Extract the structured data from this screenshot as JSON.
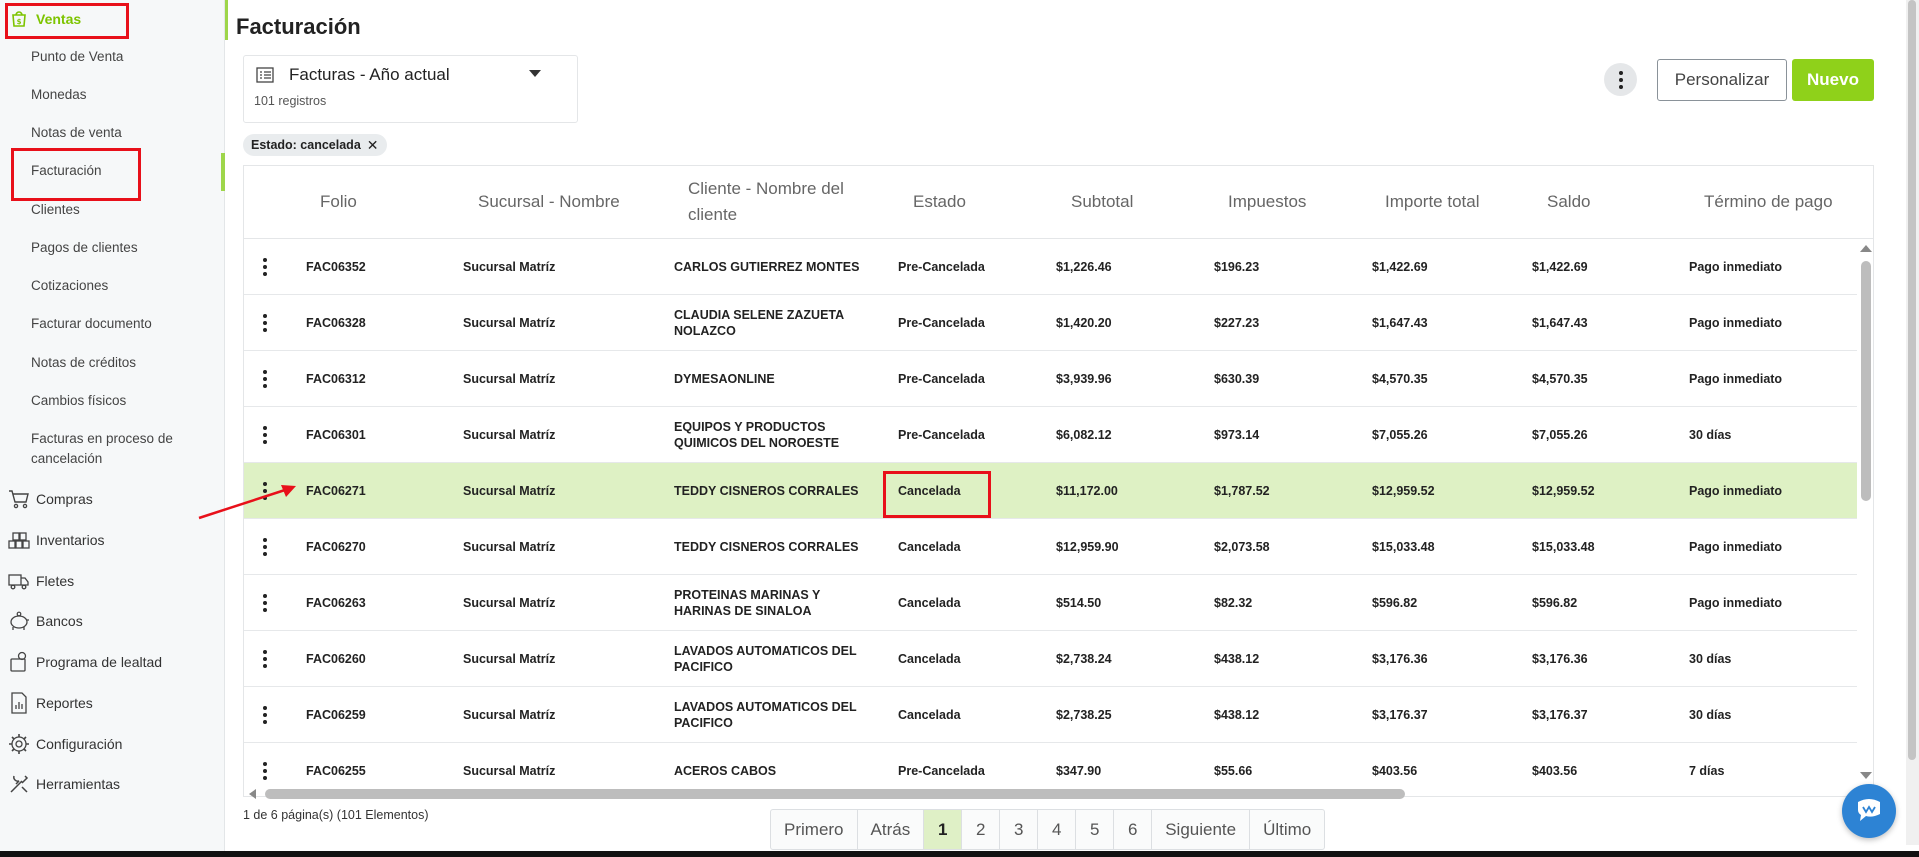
{
  "sidebar": {
    "ventas": "Ventas",
    "subitems": [
      "Punto de Venta",
      "Monedas",
      "Notas de venta",
      "Facturación",
      "Clientes",
      "Pagos de clientes",
      "Cotizaciones",
      "Facturar documento",
      "Notas de créditos",
      "Cambios físicos",
      "Facturas en proceso de",
      "cancelación"
    ],
    "parents": [
      "Compras",
      "Inventarios",
      "Fletes",
      "Bancos",
      "Programa de lealtad",
      "Reportes",
      "Configuración",
      "Herramientas"
    ]
  },
  "page": {
    "title": "Facturación",
    "view_name": "Facturas - Año actual",
    "record_count": "101 registros",
    "filter_chip": "Estado: cancelada",
    "personalizar": "Personalizar",
    "nuevo": "Nuevo"
  },
  "table": {
    "headers": [
      "Folio",
      "Sucursal - Nombre",
      "Cliente - Nombre del",
      "cliente",
      "Estado",
      "Subtotal",
      "Impuestos",
      "Importe total",
      "Saldo",
      "Término de pago"
    ],
    "rows": [
      {
        "folio": "FAC06352",
        "sucursal": "Sucursal Matríz",
        "cliente1": "CARLOS GUTIERREZ MONTES",
        "cliente2": "",
        "estado": "Pre-Cancelada",
        "subtotal": "$1,226.46",
        "impuestos": "$196.23",
        "total": "$1,422.69",
        "saldo": "$1,422.69",
        "termino": "Pago inmediato"
      },
      {
        "folio": "FAC06328",
        "sucursal": "Sucursal Matríz",
        "cliente1": "CLAUDIA SELENE ZAZUETA",
        "cliente2": "NOLAZCO",
        "estado": "Pre-Cancelada",
        "subtotal": "$1,420.20",
        "impuestos": "$227.23",
        "total": "$1,647.43",
        "saldo": "$1,647.43",
        "termino": "Pago inmediato"
      },
      {
        "folio": "FAC06312",
        "sucursal": "Sucursal Matríz",
        "cliente1": "DYMESAONLINE",
        "cliente2": "",
        "estado": "Pre-Cancelada",
        "subtotal": "$3,939.96",
        "impuestos": "$630.39",
        "total": "$4,570.35",
        "saldo": "$4,570.35",
        "termino": "Pago inmediato"
      },
      {
        "folio": "FAC06301",
        "sucursal": "Sucursal Matríz",
        "cliente1": "EQUIPOS Y PRODUCTOS",
        "cliente2": "QUIMICOS DEL NOROESTE",
        "estado": "Pre-Cancelada",
        "subtotal": "$6,082.12",
        "impuestos": "$973.14",
        "total": "$7,055.26",
        "saldo": "$7,055.26",
        "termino": "30 días"
      },
      {
        "folio": "FAC06271",
        "sucursal": "Sucursal Matríz",
        "cliente1": "TEDDY CISNEROS CORRALES",
        "cliente2": "",
        "estado": "Cancelada",
        "subtotal": "$11,172.00",
        "impuestos": "$1,787.52",
        "total": "$12,959.52",
        "saldo": "$12,959.52",
        "termino": "Pago inmediato"
      },
      {
        "folio": "FAC06270",
        "sucursal": "Sucursal Matríz",
        "cliente1": "TEDDY CISNEROS CORRALES",
        "cliente2": "",
        "estado": "Cancelada",
        "subtotal": "$12,959.90",
        "impuestos": "$2,073.58",
        "total": "$15,033.48",
        "saldo": "$15,033.48",
        "termino": "Pago inmediato"
      },
      {
        "folio": "FAC06263",
        "sucursal": "Sucursal Matríz",
        "cliente1": "PROTEINAS MARINAS Y",
        "cliente2": "HARINAS DE SINALOA",
        "estado": "Cancelada",
        "subtotal": "$514.50",
        "impuestos": "$82.32",
        "total": "$596.82",
        "saldo": "$596.82",
        "termino": "Pago inmediato"
      },
      {
        "folio": "FAC06260",
        "sucursal": "Sucursal Matríz",
        "cliente1": "LAVADOS AUTOMATICOS DEL",
        "cliente2": "PACIFICO",
        "estado": "Cancelada",
        "subtotal": "$2,738.24",
        "impuestos": "$438.12",
        "total": "$3,176.36",
        "saldo": "$3,176.36",
        "termino": "30 días"
      },
      {
        "folio": "FAC06259",
        "sucursal": "Sucursal Matríz",
        "cliente1": "LAVADOS AUTOMATICOS DEL",
        "cliente2": "PACIFICO",
        "estado": "Cancelada",
        "subtotal": "$2,738.25",
        "impuestos": "$438.12",
        "total": "$3,176.37",
        "saldo": "$3,176.37",
        "termino": "30 días"
      },
      {
        "folio": "FAC06255",
        "sucursal": "Sucursal Matríz",
        "cliente1": "ACEROS CABOS",
        "cliente2": "",
        "estado": "Pre-Cancelada",
        "subtotal": "$347.90",
        "impuestos": "$55.66",
        "total": "$403.56",
        "saldo": "$403.56",
        "termino": "7 días"
      }
    ]
  },
  "pager": {
    "info": "1 de 6 página(s) (101 Elementos)",
    "primero": "Primero",
    "atras": "Atrás",
    "pages": [
      "1",
      "2",
      "3",
      "4",
      "5",
      "6"
    ],
    "siguiente": "Siguiente",
    "ultimo": "Último"
  },
  "colors": {
    "accent_green": "#8fd11a",
    "selected_row": "#def1c4",
    "annotation_red": "#e8101a"
  }
}
